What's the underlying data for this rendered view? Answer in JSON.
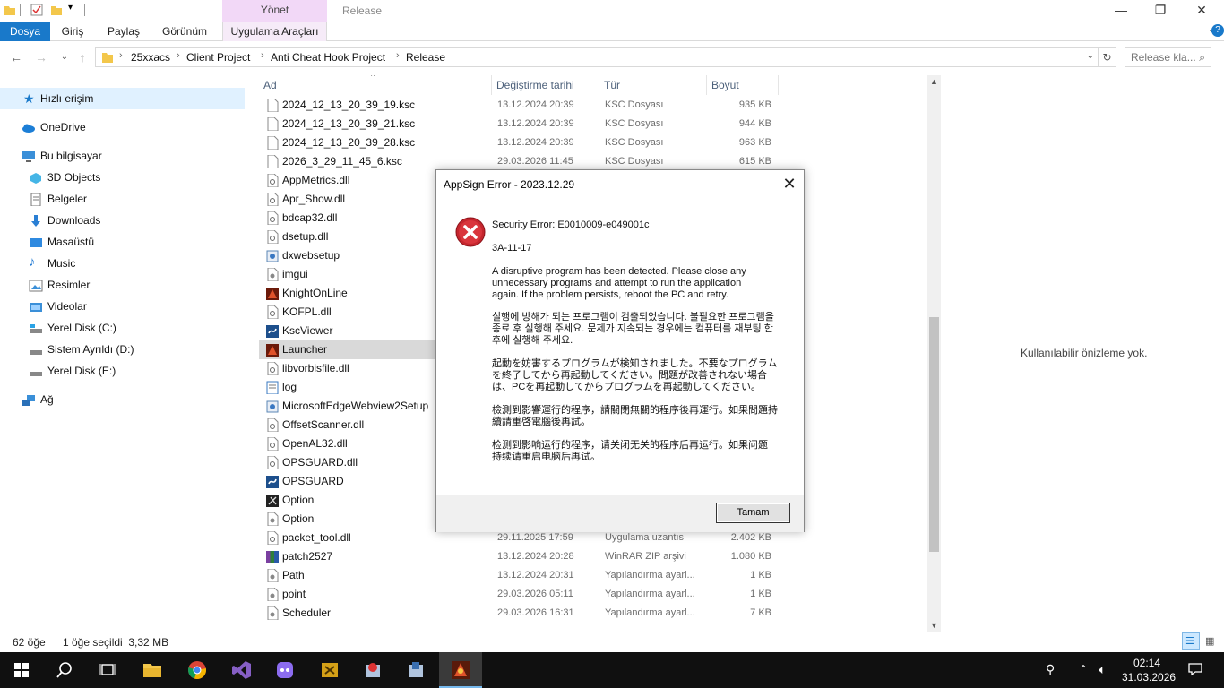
{
  "window": {
    "title": "Release",
    "contextual_group": "Yönet",
    "minimize": "—",
    "maximize": "❐",
    "close": "✕"
  },
  "ribbon": {
    "tabs": [
      "Dosya",
      "Giriş",
      "Paylaş",
      "Görünüm",
      "Uygulama Araçları"
    ]
  },
  "address": {
    "breadcrumbs": [
      "25xxacs",
      "Client Project",
      "Anti Cheat Hook Project",
      "Release"
    ],
    "search_placeholder": "Release kla..."
  },
  "nav_pane": {
    "items": [
      {
        "label": "Hızlı erişim",
        "icon": "star-icon"
      },
      {
        "label": "OneDrive",
        "icon": "cloud-icon"
      },
      {
        "label": "Bu bilgisayar",
        "icon": "computer-icon"
      },
      {
        "label": "3D Objects",
        "icon": "cube-icon"
      },
      {
        "label": "Belgeler",
        "icon": "document-icon"
      },
      {
        "label": "Downloads",
        "icon": "download-icon"
      },
      {
        "label": "Masaüstü",
        "icon": "desktop-icon"
      },
      {
        "label": "Music",
        "icon": "music-icon"
      },
      {
        "label": "Resimler",
        "icon": "pictures-icon"
      },
      {
        "label": "Videolar",
        "icon": "video-icon"
      },
      {
        "label": "Yerel Disk (C:)",
        "icon": "drive-icon"
      },
      {
        "label": "Sistem Ayrıldı (D:)",
        "icon": "drive-icon"
      },
      {
        "label": "Yerel Disk (E:)",
        "icon": "drive-icon"
      },
      {
        "label": "Ağ",
        "icon": "network-icon"
      }
    ]
  },
  "columns": {
    "name": "Ad",
    "date": "Değiştirme tarihi",
    "type": "Tür",
    "size": "Boyut"
  },
  "files": [
    {
      "name": "2024_12_13_20_39_19.ksc",
      "date": "13.12.2024 20:39",
      "type": "KSC Dosyası",
      "size": "935 KB",
      "icon": "file-icon"
    },
    {
      "name": "2024_12_13_20_39_21.ksc",
      "date": "13.12.2024 20:39",
      "type": "KSC Dosyası",
      "size": "944 KB",
      "icon": "file-icon"
    },
    {
      "name": "2024_12_13_20_39_28.ksc",
      "date": "13.12.2024 20:39",
      "type": "KSC Dosyası",
      "size": "963 KB",
      "icon": "file-icon"
    },
    {
      "name": "2026_3_29_11_45_6.ksc",
      "date": "29.03.2026 11:45",
      "type": "KSC Dosyası",
      "size": "615 KB",
      "icon": "file-icon"
    },
    {
      "name": "AppMetrics.dll",
      "date": "",
      "type": "",
      "size": "",
      "icon": "dll-icon"
    },
    {
      "name": "Apr_Show.dll",
      "date": "",
      "type": "",
      "size": "",
      "icon": "dll-icon"
    },
    {
      "name": "bdcap32.dll",
      "date": "",
      "type": "",
      "size": "",
      "icon": "dll-icon"
    },
    {
      "name": "dsetup.dll",
      "date": "",
      "type": "",
      "size": "",
      "icon": "dll-icon"
    },
    {
      "name": "dxwebsetup",
      "date": "",
      "type": "",
      "size": "",
      "icon": "setup-icon"
    },
    {
      "name": "imgui",
      "date": "",
      "type": "",
      "size": "",
      "icon": "config-icon"
    },
    {
      "name": "KnightOnLine",
      "date": "",
      "type": "",
      "size": "",
      "icon": "game-icon"
    },
    {
      "name": "KOFPL.dll",
      "date": "",
      "type": "",
      "size": "",
      "icon": "dll-icon"
    },
    {
      "name": "KscViewer",
      "date": "",
      "type": "",
      "size": "",
      "icon": "app-icon"
    },
    {
      "name": "Launcher",
      "date": "",
      "type": "",
      "size": "",
      "icon": "game-icon"
    },
    {
      "name": "libvorbisfile.dll",
      "date": "",
      "type": "",
      "size": "",
      "icon": "dll-icon"
    },
    {
      "name": "log",
      "date": "",
      "type": "",
      "size": "",
      "icon": "text-icon"
    },
    {
      "name": "MicrosoftEdgeWebview2Setup",
      "date": "",
      "type": "",
      "size": "",
      "icon": "setup-icon"
    },
    {
      "name": "OffsetScanner.dll",
      "date": "",
      "type": "",
      "size": "",
      "icon": "dll-icon"
    },
    {
      "name": "OpenAL32.dll",
      "date": "",
      "type": "",
      "size": "",
      "icon": "dll-icon"
    },
    {
      "name": "OPSGUARD.dll",
      "date": "",
      "type": "",
      "size": "",
      "icon": "dll-icon"
    },
    {
      "name": "OPSGUARD",
      "date": "",
      "type": "",
      "size": "",
      "icon": "app-icon"
    },
    {
      "name": "Option",
      "date": "",
      "type": "",
      "size": "",
      "icon": "option-icon"
    },
    {
      "name": "Option",
      "date": "",
      "type": "",
      "size": "",
      "icon": "config-icon"
    },
    {
      "name": "packet_tool.dll",
      "date": "29.11.2025 17:59",
      "type": "Uygulama uzantısı",
      "size": "2.402 KB",
      "icon": "dll-icon"
    },
    {
      "name": "patch2527",
      "date": "13.12.2024 20:28",
      "type": "WinRAR ZIP arşivi",
      "size": "1.080 KB",
      "icon": "archive-icon"
    },
    {
      "name": "Path",
      "date": "13.12.2024 20:31",
      "type": "Yapılandırma ayarl...",
      "size": "1 KB",
      "icon": "config-icon"
    },
    {
      "name": "point",
      "date": "29.03.2026 05:11",
      "type": "Yapılandırma ayarl...",
      "size": "1 KB",
      "icon": "config-icon"
    },
    {
      "name": "Scheduler",
      "date": "29.03.2026 16:31",
      "type": "Yapılandırma ayarl...",
      "size": "7 KB",
      "icon": "config-icon"
    }
  ],
  "preview_text": "Kullanılabilir önizleme yok.",
  "status": {
    "count": "62 öğe",
    "selection": "1 öğe seçildi  3,32 MB"
  },
  "dialog": {
    "title": "AppSign Error - 2023.12.29",
    "error_line": "Security Error: E0010009-e049001c",
    "code": "3A-11-17",
    "msg_en": "A disruptive program has been detected. Please close any unnecessary programs and attempt to run the application again. If the problem persists, reboot the PC and retry.",
    "msg_ko": "실행에 방해가 되는 프로그램이 검출되었습니다. 불필요한 프로그램을 종료 후 실행해 주세요. 문제가 지속되는 경우에는 컴퓨터를 재부팅 한 후에 실행해 주세요.",
    "msg_ja": "起動を妨害するプログラムが検知されました。不要なプログラムを終了してから再起動してください。問題が改善されない場合は、PCを再起動してからプログラムを再起動してください。",
    "msg_zh_tw": "檢測到影響運行的程序，請關閉無關的程序後再運行。如果問題持續請重啓電腦後再試。",
    "msg_zh_cn": "检测到影响运行的程序，请关闭无关的程序后再运行。如果问题持续请重启电脑后再试。",
    "ok": "Tamam",
    "icon": "error-icon"
  },
  "taskbar": {
    "time": "02:14",
    "date": "31.03.2026",
    "apps": [
      "start-icon",
      "search-icon",
      "task-view-icon",
      "file-explorer-icon",
      "chrome-icon",
      "visual-studio-icon",
      "discord-icon",
      "cheat-engine-icon",
      "app-icon",
      "app-icon",
      "launcher-icon"
    ]
  },
  "colors": {
    "accent": "#1979ca",
    "selection": "#cce8ff",
    "contextual": "#f2d8f7",
    "error": "#c4262e"
  }
}
